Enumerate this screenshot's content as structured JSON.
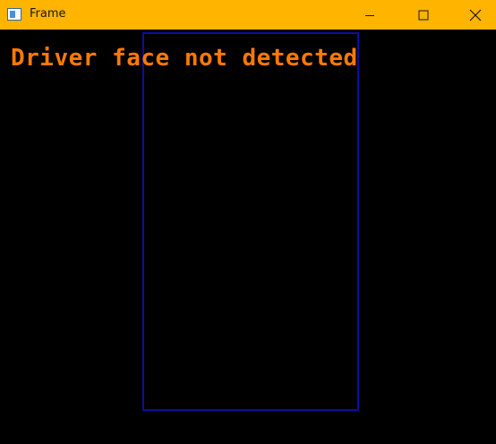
{
  "window": {
    "title": "Frame",
    "titlebar_color": "#ffb400",
    "icons": {
      "app": "app-window-icon",
      "minimize": "minimize-icon",
      "maximize": "maximize-icon",
      "close": "close-icon"
    }
  },
  "frame": {
    "status_text": "Driver face not detected",
    "status_color": "#ff7a00",
    "box_color": "#0d0da0",
    "background": "#000000"
  }
}
